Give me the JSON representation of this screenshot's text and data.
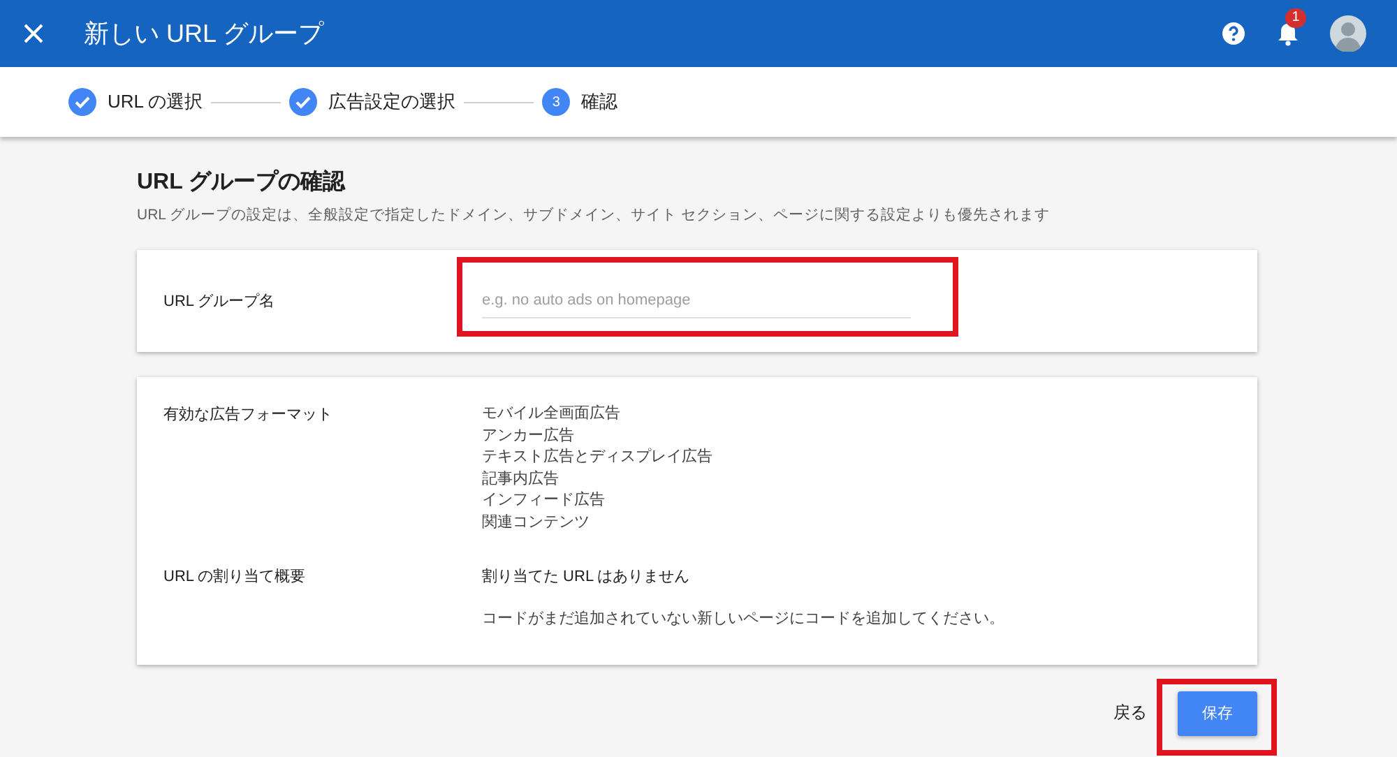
{
  "header": {
    "title": "新しい URL グループ",
    "notification_count": "1"
  },
  "steps": [
    {
      "label": "URL の選択",
      "completed": true
    },
    {
      "label": "広告設定の選択",
      "completed": true
    },
    {
      "label": "確認",
      "completed": false,
      "number": "3"
    }
  ],
  "page": {
    "title": "URL グループの確認",
    "subtitle": "URL グループの設定は、全般設定で指定したドメイン、サブドメイン、サイト セクション、ページに関する設定よりも優先されます"
  },
  "name_card": {
    "label": "URL グループ名",
    "placeholder": "e.g. no auto ads on homepage",
    "highlighted": true
  },
  "summary_card": {
    "formats_label": "有効な広告フォーマット",
    "formats": [
      "モバイル全画面広告",
      "アンカー広告",
      "テキスト広告とディスプレイ広告",
      "記事内広告",
      "インフィード広告",
      "関連コンテンツ"
    ],
    "assignment_label": "URL の割り当て概要",
    "assignment_value": "割り当てた URL はありません",
    "assignment_note": "コードがまだ追加されていない新しいページにコードを追加してください。"
  },
  "actions": {
    "back": "戻る",
    "save": "保存",
    "save_highlighted": true
  }
}
